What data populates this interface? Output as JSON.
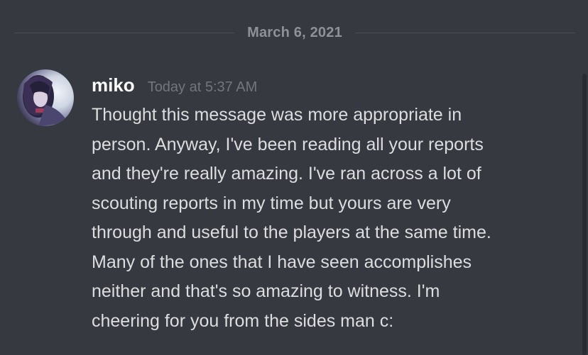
{
  "divider": {
    "date": "March 6, 2021"
  },
  "message": {
    "author": "miko",
    "timestamp": "Today at 5:37 AM",
    "text": "Thought this message was more appropriate in\nperson. Anyway, I've been reading all your reports\nand they're really amazing. I've ran across a lot of\nscouting reports in my time but yours are very\nthrough and useful to the players at the same time.\nMany of the ones that I have seen accomplishes\nneither and that's so amazing to witness. I'm\ncheering for you from the sides man c:"
  },
  "colors": {
    "background": "#36393f",
    "username": "#ffffff",
    "timestamp": "#72767d",
    "message_text": "#dcddde",
    "divider_text": "#8e9297"
  }
}
